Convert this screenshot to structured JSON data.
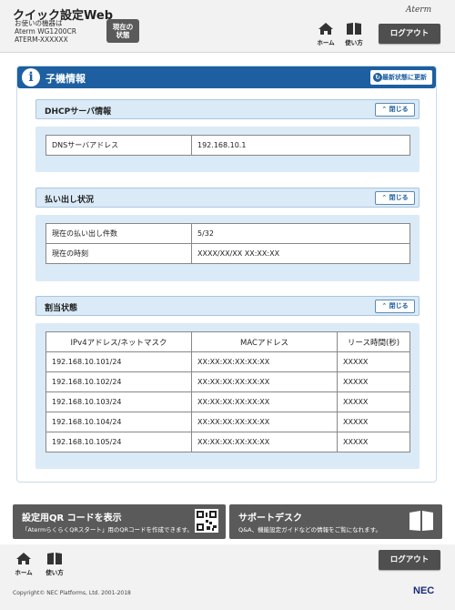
{
  "header": {
    "app_title": "クイック設定Web",
    "device_label": "お使いの機器は",
    "device_model": "Aterm WG1200CR",
    "device_name": "ATERM-XXXXXX",
    "status_button_line1": "現在の",
    "status_button_line2": "状態",
    "brand": "Aterm",
    "home_label": "ホーム",
    "help_label": "使い方",
    "logout_label": "ログアウト"
  },
  "panel": {
    "title": "子機情報",
    "refresh_label": "最新状態に更新",
    "close_label": "閉じる"
  },
  "dhcp": {
    "title": "DHCPサーバ情報",
    "dns_label": "DNSサーバアドレス",
    "dns_value": "192.168.10.1"
  },
  "lease": {
    "title": "払い出し状況",
    "count_label": "現在の払い出し件数",
    "count_value": "5/32",
    "time_label": "現在の時刻",
    "time_value": "XXXX/XX/XX XX:XX:XX"
  },
  "assign": {
    "title": "割当状態",
    "columns": [
      "IPv4アドレス/ネットマスク",
      "MACアドレス",
      "リース時間(秒)"
    ],
    "rows": [
      {
        "ip": "192.168.10.101/24",
        "mac": "XX:XX:XX:XX:XX:XX",
        "lease": "XXXXX"
      },
      {
        "ip": "192.168.10.102/24",
        "mac": "XX:XX:XX:XX:XX:XX",
        "lease": "XXXXX"
      },
      {
        "ip": "192.168.10.103/24",
        "mac": "XX:XX:XX:XX:XX:XX",
        "lease": "XXXXX"
      },
      {
        "ip": "192.168.10.104/24",
        "mac": "XX:XX:XX:XX:XX:XX",
        "lease": "XXXXX"
      },
      {
        "ip": "192.168.10.105/24",
        "mac": "XX:XX:XX:XX:XX:XX",
        "lease": "XXXXX"
      }
    ]
  },
  "cards": {
    "qr_title": "設定用QR コードを表示",
    "qr_desc": "「AtermらくらくQRスタート」用のQRコードを作成できます。",
    "support_title": "サポートデスク",
    "support_desc": "Q&A、機能設定ガイドなどの情報をご覧になれます。"
  },
  "footer": {
    "home_label": "ホーム",
    "help_label": "使い方",
    "logout_label": "ログアウト",
    "copyright": "Copyright© NEC Platforms, Ltd. 2001-2018",
    "brand": "NEC"
  },
  "colors": {
    "accent": "#1d5fa0",
    "section_bg": "#dbeaf7",
    "button_dark": "#4f4f4f"
  }
}
